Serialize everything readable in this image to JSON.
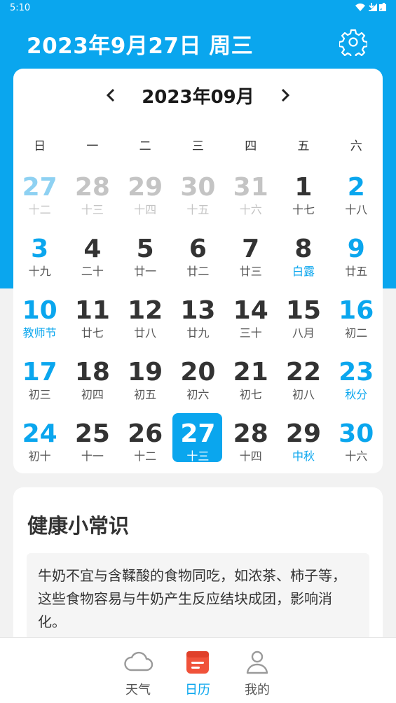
{
  "status_bar": {
    "time": "5:10"
  },
  "header": {
    "date_text": "2023年9月27日 周三"
  },
  "calendar": {
    "month_title": "2023年09月",
    "weekdays": [
      "日",
      "一",
      "二",
      "三",
      "四",
      "五",
      "六"
    ],
    "weeks": [
      [
        {
          "num": "27",
          "lunar": "十二",
          "other": true
        },
        {
          "num": "28",
          "lunar": "十三",
          "other": true
        },
        {
          "num": "29",
          "lunar": "十四",
          "other": true
        },
        {
          "num": "30",
          "lunar": "十五",
          "other": true
        },
        {
          "num": "31",
          "lunar": "十六",
          "other": true
        },
        {
          "num": "1",
          "lunar": "十七"
        },
        {
          "num": "2",
          "lunar": "十八"
        }
      ],
      [
        {
          "num": "3",
          "lunar": "十九"
        },
        {
          "num": "4",
          "lunar": "二十"
        },
        {
          "num": "5",
          "lunar": "廿一"
        },
        {
          "num": "6",
          "lunar": "廿二"
        },
        {
          "num": "7",
          "lunar": "廿三"
        },
        {
          "num": "8",
          "lunar": "白露",
          "festival": true
        },
        {
          "num": "9",
          "lunar": "廿五"
        }
      ],
      [
        {
          "num": "10",
          "lunar": "教师节",
          "festival": true
        },
        {
          "num": "11",
          "lunar": "廿七"
        },
        {
          "num": "12",
          "lunar": "廿八"
        },
        {
          "num": "13",
          "lunar": "廿九"
        },
        {
          "num": "14",
          "lunar": "三十"
        },
        {
          "num": "15",
          "lunar": "八月"
        },
        {
          "num": "16",
          "lunar": "初二"
        }
      ],
      [
        {
          "num": "17",
          "lunar": "初三"
        },
        {
          "num": "18",
          "lunar": "初四"
        },
        {
          "num": "19",
          "lunar": "初五"
        },
        {
          "num": "20",
          "lunar": "初六"
        },
        {
          "num": "21",
          "lunar": "初七"
        },
        {
          "num": "22",
          "lunar": "初八"
        },
        {
          "num": "23",
          "lunar": "秋分",
          "festival": true
        }
      ],
      [
        {
          "num": "24",
          "lunar": "初十"
        },
        {
          "num": "25",
          "lunar": "十一"
        },
        {
          "num": "26",
          "lunar": "十二"
        },
        {
          "num": "27",
          "lunar": "十三",
          "selected": true
        },
        {
          "num": "28",
          "lunar": "十四"
        },
        {
          "num": "29",
          "lunar": "中秋",
          "festival": true
        },
        {
          "num": "30",
          "lunar": "十六"
        }
      ]
    ]
  },
  "health": {
    "title": "健康小常识",
    "text": "牛奶不宜与含鞣酸的食物同吃，如浓茶、柿子等，这些食物容易与牛奶产生反应结块成团，影响消化。"
  },
  "bottom_nav": {
    "items": [
      {
        "label": "天气",
        "icon": "cloud-icon"
      },
      {
        "label": "日历",
        "icon": "calendar-icon",
        "active": true
      },
      {
        "label": "我的",
        "icon": "profile-icon"
      }
    ]
  },
  "colors": {
    "accent": "#0aa6ee",
    "background": "#f2f2f2"
  }
}
